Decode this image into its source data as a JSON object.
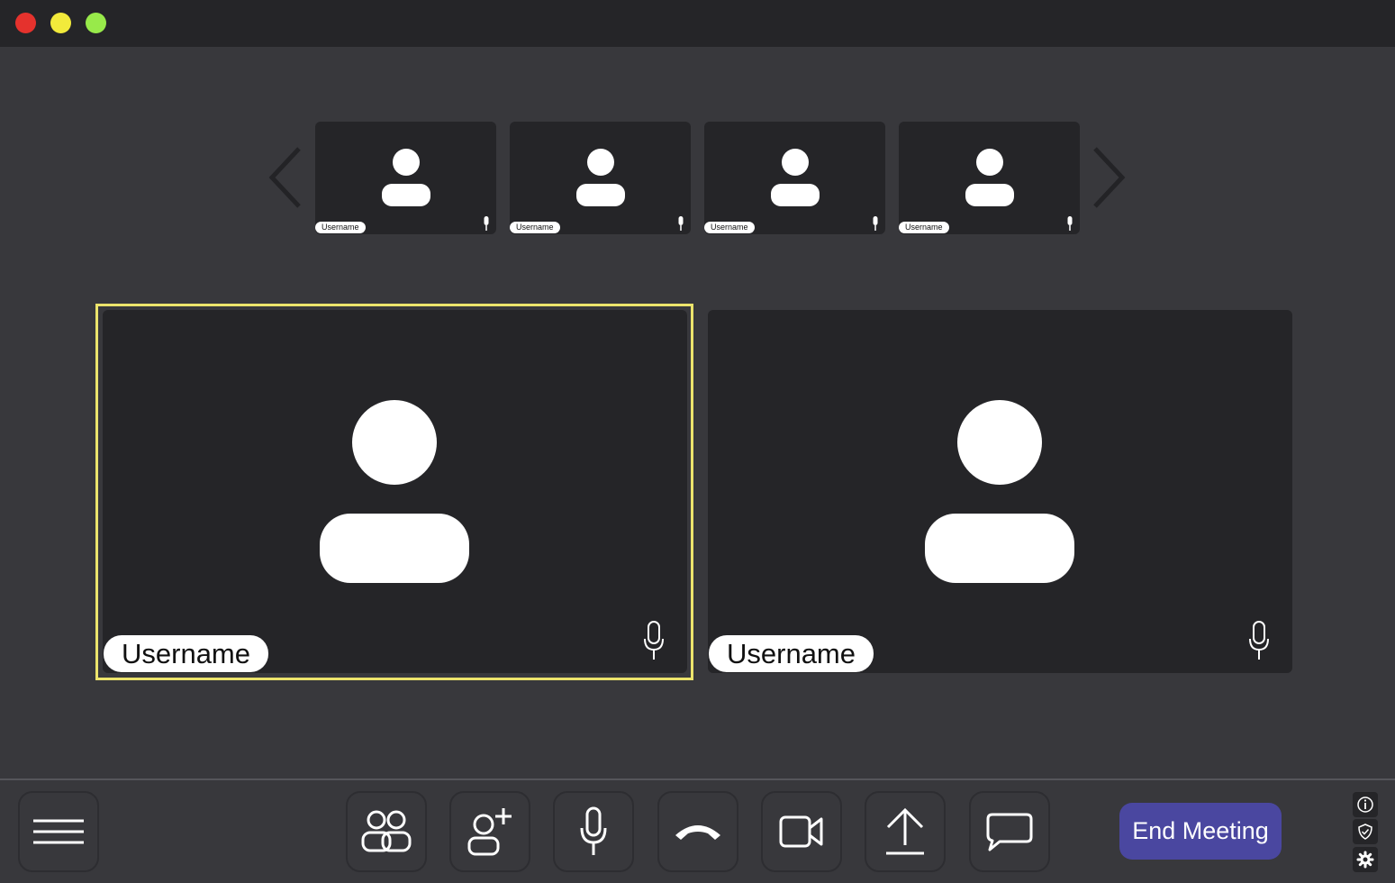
{
  "window": {
    "controls": [
      "close",
      "minimize",
      "maximize"
    ],
    "colors": {
      "close": "#e5322d",
      "minimize": "#f2ea3b",
      "maximize": "#98ea4a"
    }
  },
  "thumbnail_strip": {
    "prev_icon": "chevron-left-icon",
    "next_icon": "chevron-right-icon",
    "participants": [
      {
        "username": "Username",
        "mic_icon": "mic-icon"
      },
      {
        "username": "Username",
        "mic_icon": "mic-icon"
      },
      {
        "username": "Username",
        "mic_icon": "mic-icon"
      },
      {
        "username": "Username",
        "mic_icon": "mic-icon"
      }
    ]
  },
  "main_tiles": [
    {
      "username": "Username",
      "active_speaker": true,
      "mic_icon": "mic-icon"
    },
    {
      "username": "Username",
      "active_speaker": false,
      "mic_icon": "mic-icon"
    }
  ],
  "toolbar": {
    "menu_icon": "menu-icon",
    "buttons": [
      {
        "icon": "participants-icon"
      },
      {
        "icon": "add-user-icon"
      },
      {
        "icon": "mic-icon"
      },
      {
        "icon": "hang-up-icon"
      },
      {
        "icon": "video-camera-icon"
      },
      {
        "icon": "share-screen-icon"
      },
      {
        "icon": "chat-icon"
      }
    ],
    "end_meeting_label": "End Meeting",
    "end_meeting_color": "#4a47a0",
    "side_icons": [
      "info-icon",
      "shield-icon",
      "settings-icon"
    ]
  },
  "colors": {
    "background": "#38383c",
    "tile": "#252528",
    "active_speaker_border": "#ece46c"
  }
}
